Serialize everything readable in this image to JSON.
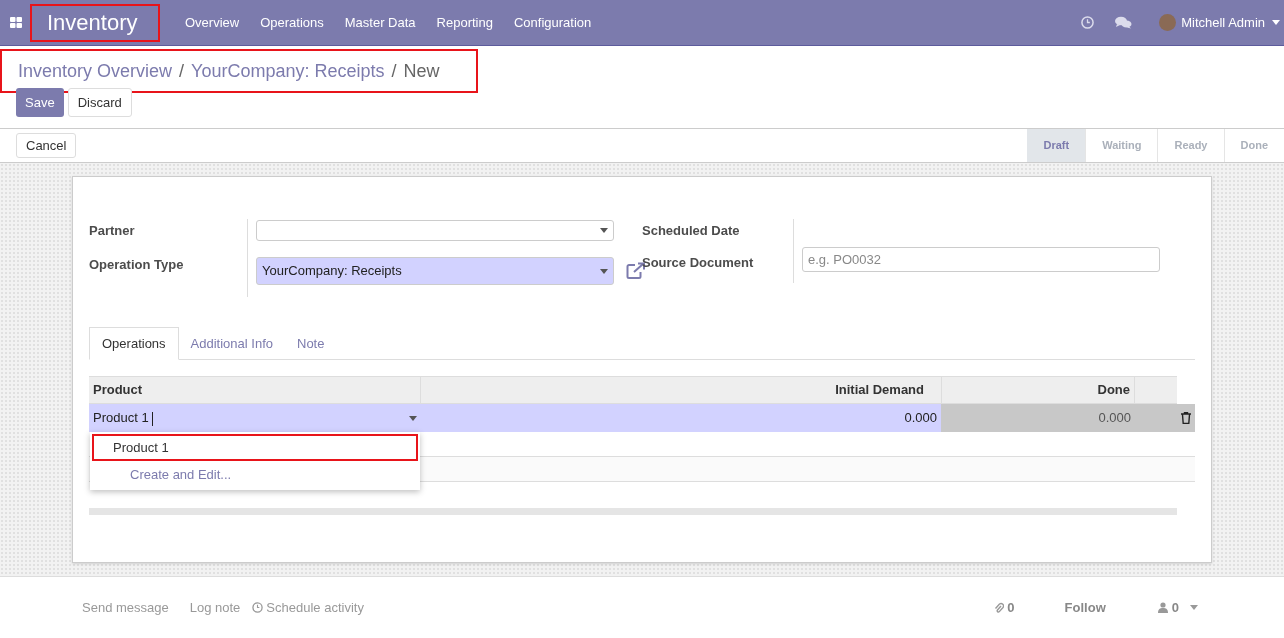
{
  "navbar": {
    "app": {
      "label": "Inventory",
      "highlighted": true
    },
    "menu": [
      "Overview",
      "Operations",
      "Master Data",
      "Reporting",
      "Configuration"
    ],
    "user": "Mitchell Admin"
  },
  "breadcrumb": {
    "highlighted": true,
    "separator": "/",
    "items": [
      {
        "label": "Inventory Overview",
        "link": true
      },
      {
        "label": "YourCompany: Receipts",
        "link": true
      },
      {
        "label": "New",
        "link": false
      }
    ]
  },
  "actions": [
    "Save",
    "Discard"
  ],
  "status_bar": {
    "button": "Cancel",
    "stages": [
      {
        "label": "Draft",
        "selected": true
      },
      {
        "label": "Waiting",
        "selected": false
      },
      {
        "label": "Ready",
        "selected": false
      },
      {
        "label": "Done",
        "selected": false
      }
    ]
  },
  "form": {
    "left": [
      {
        "label": "Partner",
        "required": false
      },
      {
        "label": "Operation Type",
        "value": "YourCompany: Receipts",
        "required": true
      }
    ],
    "right": [
      {
        "label": "Scheduled Date"
      },
      {
        "label": "Source Document",
        "placeholder": "e.g. PO0032"
      }
    ]
  },
  "tabs": [
    {
      "label": "Operations",
      "selected": true
    },
    {
      "label": "Additional Info",
      "selected": false
    },
    {
      "label": "Note",
      "selected": false
    }
  ],
  "table": {
    "columns": [
      "Product",
      "Initial Demand",
      "Done"
    ],
    "rows": [
      {
        "product": "Product 1",
        "initial_demand": "0.000",
        "done": "0.000"
      }
    ]
  },
  "autocomplete": [
    {
      "label": "Product 1",
      "kind": "option",
      "highlighted": true
    },
    {
      "label": "Create and Edit...",
      "kind": "action",
      "highlighted": false
    }
  ],
  "chatter": {
    "actions": [
      "Send message",
      "Log note",
      "Schedule activity"
    ],
    "attachments": "0",
    "follow": "Follow",
    "followers": "0"
  }
}
